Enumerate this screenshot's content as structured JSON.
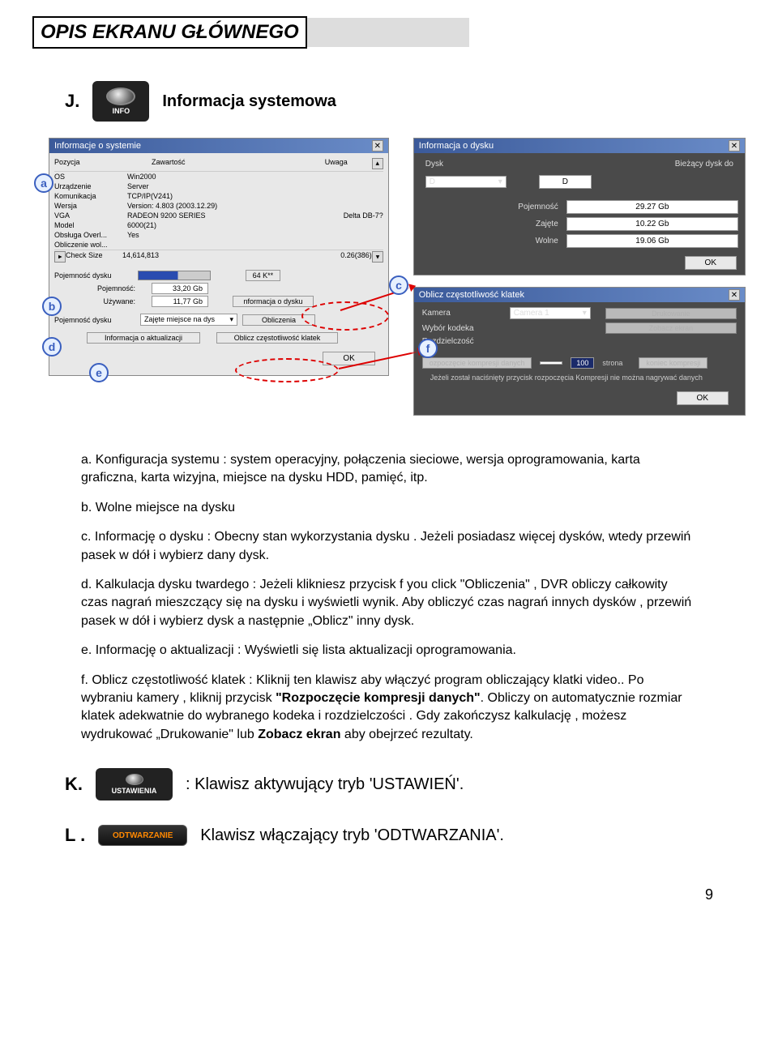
{
  "page_title": "OPIS EKRANU GŁÓWNEGO",
  "page_number": "9",
  "section_j": {
    "letter": "J.",
    "label": "Informacja systemowa",
    "icon_sub": "INFO"
  },
  "markers": {
    "a": "a",
    "b": "b",
    "c": "c",
    "d": "d",
    "e": "e",
    "f": "f"
  },
  "win_sysinfo": {
    "title": "Informacje o systemie",
    "cols": {
      "c1": "Pozycja",
      "c2": "Zawartość",
      "c3": "Uwaga"
    },
    "rows": [
      {
        "c1": "OS",
        "c2": "Win2000",
        "c3": ""
      },
      {
        "c1": "Urządzenie",
        "c2": "Server",
        "c3": ""
      },
      {
        "c1": "Komunikacja",
        "c2": "TCP/IP(V241)",
        "c3": ""
      },
      {
        "c1": "Wersja",
        "c2": "Version: 4.803 (2003.12.29)",
        "c3": ""
      },
      {
        "c1": "VGA",
        "c2": "RADEON 9200 SERIES",
        "c3": "Delta DB-7?"
      },
      {
        "c1": "Model",
        "c2": "6000(21)",
        "c3": ""
      },
      {
        "c1": "Obsługa Overl...",
        "c2": "Yes",
        "c3": ""
      },
      {
        "c1": "Obliczenie wol...",
        "c2": "",
        "c3": ""
      },
      {
        "c1": "Check Size",
        "c2": "14,614,813",
        "c3": "0.26(386)"
      }
    ],
    "disk_cap_label": "Pojemność dysku",
    "k_poj": "Pojemność:",
    "v_poj": "33,20 Gb",
    "k_uzy": "Używane:",
    "v_uzy": "11,77 Gb",
    "btn_info_dysk": "nformacja o dysku",
    "btn_64": "64 K**",
    "row_poj_label": "Pojemność dysku",
    "sel_zajete": "Zajęte miejsce na dys",
    "btn_oblicz": "Obliczenia",
    "btn_info_akt": "Informacja o aktualizacji",
    "btn_czest": "Oblicz częstotliwość klatek",
    "ok": "OK"
  },
  "win_disk": {
    "title": "Informacja o dysku",
    "lbl_dysk": "Dysk",
    "lbl_biez": "Bieżący dysk do",
    "sel_d": "D",
    "val_d": "D",
    "k_poj": "Pojemność",
    "v_poj": "29.27 Gb",
    "k_zaj": "Zajęte",
    "v_zaj": "10.22 Gb",
    "k_wol": "Wolne",
    "v_wol": "19.06 Gb",
    "ok": "OK"
  },
  "win_freq": {
    "title": "Oblicz częstotliwość klatek",
    "lbl_kam": "Kamera",
    "sel_kam": "Camera 1",
    "lbl_kod": "Wybór kodeka",
    "lbl_roz": "Rozdzielczość",
    "btn_druk": "Drukowanie",
    "btn_zob": "Zobacz ekran",
    "lbl_start": "ozpoczęcie kompresji danych",
    "lbl_page": "strona",
    "val_page": "100",
    "lbl_end": "koniec kompresji",
    "note": "Jeżeli został naciśnięty przycisk rozpoczęcia Kompresji nie można nagrywać danych",
    "ok": "OK"
  },
  "list": {
    "a": {
      "prefix": "a. Konfiguracja systemu",
      "rest": "  : system operacyjny, połączenia sieciowe, wersja oprogramowania, karta graficzna, karta wizyjna, miejsce na dysku HDD, pamięć, itp."
    },
    "b": "b. Wolne miejsce na dysku",
    "c": {
      "prefix": "c. Informację o dysku",
      "rest": "  : Obecny stan wykorzystania dysku . Jeżeli posiadasz więcej dysków, wtedy przewiń pasek w dół i wybierz dany dysk."
    },
    "d": {
      "prefix": "d. Kalkulacja dysku twardego",
      "rest": "  : Jeżeli klikniesz przycisk f you click \"Obliczenia\" , DVR obliczy całkowity czas nagrań mieszczący się na dysku i wyświetli wynik. Aby obliczyć czas nagrań innych dysków , przewiń pasek w dół i wybierz dysk a następnie „Oblicz\" inny dysk."
    },
    "e": {
      "prefix": "e. Informację o aktualizacji :",
      "rest": " Wyświetli się lista aktualizacji oprogramowania."
    },
    "f": {
      "prefix": "f. Oblicz częstotliwość klatek :",
      "rest": " Kliknij ten klawisz aby włączyć program obliczający klatki video.. Po wybraniu kamery , kliknij przycisk ",
      "bold1": "\"Rozpoczęcie kompresji danych\"",
      "rest2": ". Obliczy on automatycznie rozmiar klatek adekwatnie do wybranego kodeka i rozdzielczości . Gdy zakończysz kalkulację , możesz wydrukować „Drukowanie\"  lub ",
      "bold2": "Zobacz ekran",
      "rest3": " aby obejrzeć rezultaty."
    }
  },
  "section_k": {
    "letter": "K.",
    "icon": "USTAWIENIA",
    "text": ": Klawisz aktywujący tryb 'USTAWIEŃ'."
  },
  "section_l": {
    "letter": "L .",
    "icon": "ODTWARZANIE",
    "text": "Klawisz włączający tryb 'ODTWARZANIA'."
  }
}
